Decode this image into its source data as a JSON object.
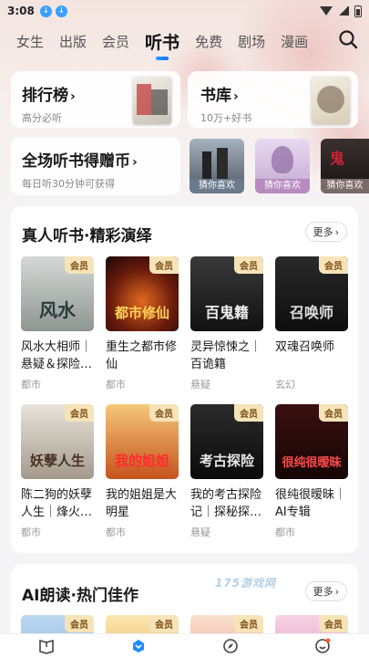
{
  "status_bar": {
    "time": "3:08"
  },
  "tabs": [
    {
      "label": "女生"
    },
    {
      "label": "出版"
    },
    {
      "label": "会员"
    },
    {
      "label": "听书"
    },
    {
      "label": "免费"
    },
    {
      "label": "剧场"
    },
    {
      "label": "漫画"
    }
  ],
  "top_cards": {
    "ranking": {
      "title": "排行榜",
      "subtitle": "高分必听"
    },
    "library": {
      "title": "书库",
      "subtitle": "10万+好书"
    },
    "coins": {
      "title": "全场听书得赠币",
      "subtitle": "每日听30分钟可获得"
    }
  },
  "free_picks": [
    {
      "tag": "猜你喜欢",
      "tag_color": "#6b7a8c"
    },
    {
      "tag": "猜你喜欢",
      "tag_color": "#b78ac0"
    },
    {
      "tag": "猜你喜欢",
      "tag_color": "#7a6a6a"
    }
  ],
  "section_real": {
    "title": "真人听书·精彩演绎",
    "more_label": "更多",
    "books": [
      {
        "name": "风水大相师｜悬疑＆探险…",
        "category": "都市",
        "vip": "会员",
        "cover_text": "风水"
      },
      {
        "name": "重生之都市修仙",
        "category": "都市",
        "vip": "会员",
        "cover_text": "都市修仙"
      },
      {
        "name": "灵异惊悚之｜百诡籍",
        "category": "悬疑",
        "vip": "会员",
        "cover_text": "百鬼籍"
      },
      {
        "name": "双魂召唤师",
        "category": "玄幻",
        "vip": "会员",
        "cover_text": "召唤师"
      },
      {
        "name": "陈二狗的妖孽人生｜烽火…",
        "category": "都市",
        "vip": "会员",
        "cover_text": "妖孽人生"
      },
      {
        "name": "我的姐姐是大明星",
        "category": "都市",
        "vip": "会员",
        "cover_text": "我的姐姐"
      },
      {
        "name": "我的考古探险记｜探秘探…",
        "category": "悬疑",
        "vip": "会员",
        "cover_text": "考古探险"
      },
      {
        "name": "很纯很暧昧｜AI专辑",
        "category": "都市",
        "vip": "会员",
        "cover_text": "很纯很暧昧"
      }
    ]
  },
  "section_ai": {
    "title": "AI朗读·热门佳作",
    "more_label": "更多",
    "vip_labels": [
      "会员",
      "会员",
      "会员",
      "会员"
    ]
  },
  "watermark": "175游戏网"
}
